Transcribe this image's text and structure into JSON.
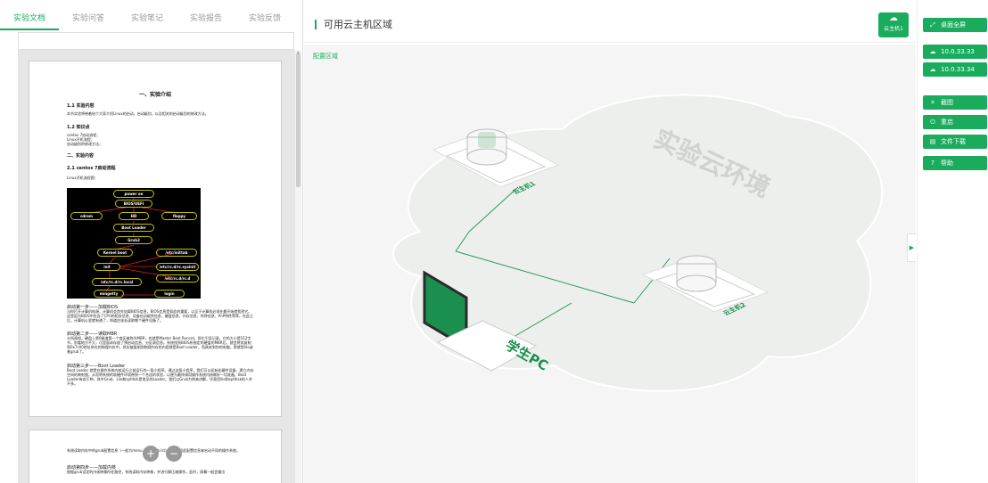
{
  "tabs": [
    "实验文档",
    "实验问答",
    "实验笔记",
    "实验报告",
    "实验反馈"
  ],
  "doc": {
    "title": "一、实验介绍",
    "h1": "1.1 实验内容",
    "p1": "本节实验将带着给个大家介绍Linux的启动，启动级别，以及相关的启动级别的修改方法。",
    "h2": "1.2 知识点",
    "p2a": "centos 7启动流程；",
    "p2b": "Linux开机流程；",
    "p2c": "启动级别的修改方法；",
    "h3": "二、实验内容",
    "h4": "2.1 centos 7启动流程",
    "p4": "Linux开机流程图：",
    "boot_nodes": [
      "power on",
      "BIOS/UEFI",
      "cdrom",
      "HD",
      "floppy",
      "Boot Loader",
      "Grub2",
      "Kernel boot",
      "/etc/inittab",
      "init",
      "/etc/rc.d/rc.sysinit",
      "/etc/rc.d/rc.d",
      "/etc/rc.d/rc.local",
      "mingetty",
      "login"
    ],
    "s1": "启动第一步——加载BIOS",
    "s1_body": "当你打开计算机电源，计算机会首先加载BIOS信息，BIOS信息是如此的重要，以至于计算机必须在最开始就找到它。这是因为BIOS中包含了CPU的相关信息、设备启动顺序信息、硬盘信息、内存信息、时钟信息、PnP特性等等。在此之后，计算机心里就有谱了，知道应该去读取哪个硬件设备了。",
    "s2": "启动第二步——读取MBR",
    "s2_body": "众所周知，硬盘上第0磁道第一个扇区被称为MBR，也就是Master Boot Record，即主引导记录，它的大小是512字节，别看地方不大，可里面却存放了预启动信息、分区表信息。系统找到BIOS所指定的硬盘的MBR后，就会将其复制到0x7c00地址所在的物理内存中。其实被复制到物理内存的内容就是Boot Loader，而具体到你的电脑，那就是lilo或者grub了。",
    "s3": "启动第三步——Boot Loader",
    "s3_body": "Boot Loader 就是在操作系统内核运行之前运行的一段小程序。通过这段小程序，我们可以初始化硬件设备、建立内存空间的映射图，从而将系统的软硬件环境带到一个合适的状态，以便为最终调用操作系统内核做好一切准备。Boot Loader有若干种，其中Grub、Lilo和spfdisk是常见的Loader。我们以Grub为例来讲解，毕竟用lilo和spfdisk的人并不多。",
    "p5": "系统读取内存中的grub配置信息（一般为menu.lst或grub.lst），并依照此配置信息来启动不同的操作系统。",
    "s4": "启动第四步——加载内核",
    "s4_body": "根据grub设定的内核映像所在路径，系统读取内存映像，并进行解压缩操作。此时，屏幕一般会输出"
  },
  "center": {
    "title": "可用云主机区域",
    "cloud_btn": "云主机1",
    "config": "配置区域",
    "env_label": "实验云环境",
    "host1": "云主机1",
    "host2": "云主机2",
    "pc": "学生PC"
  },
  "right": {
    "fullscreen": "桌面全屏",
    "ip1": "10.0.33.33",
    "ip2": "10.0.33.34",
    "screenshot": "截图",
    "restart": "重启",
    "download": "文件下载",
    "help": "帮助"
  },
  "colors": {
    "accent": "#1aac5c"
  }
}
